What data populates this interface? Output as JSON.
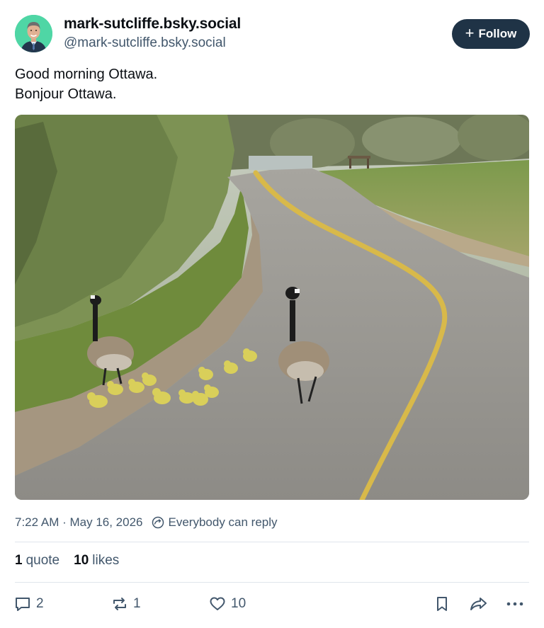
{
  "author": {
    "display_name": "mark-sutcliffe.bsky.social",
    "handle": "@mark-sutcliffe.bsky.social",
    "avatar_icon": "avatar-photo"
  },
  "follow_button": {
    "label": "Follow",
    "icon": "plus-icon"
  },
  "post": {
    "lines": [
      "Good morning Ottawa.",
      "Bonjour Ottawa."
    ],
    "image_icon": "geese-on-path-photo"
  },
  "meta": {
    "timestamp": "7:22 AM · May 16, 2026",
    "reply_setting": "Everybody can reply"
  },
  "counts": {
    "quotes_num": "1",
    "quotes_label": "quote",
    "likes_num": "10",
    "likes_label": "likes"
  },
  "actions": {
    "reply_count": "2",
    "repost_count": "1",
    "like_count": "10"
  },
  "colors": {
    "follow_button_bg": "#1f3346",
    "muted_text": "#42576c",
    "divider": "#dfe5ec",
    "avatar_bg": "#4fd6a5"
  }
}
